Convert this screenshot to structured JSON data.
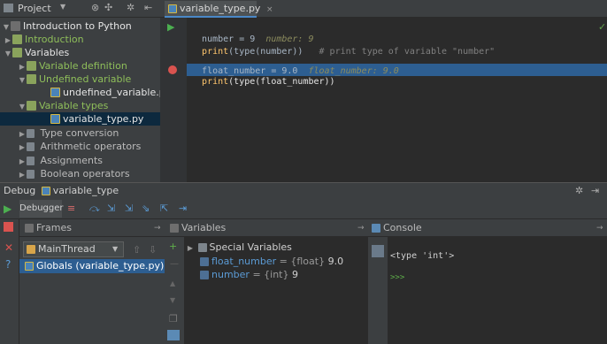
{
  "project_panel": {
    "title": "Project",
    "tree": [
      {
        "label": "Introduction to Python"
      },
      {
        "label": "Introduction"
      },
      {
        "label": "Variables"
      },
      {
        "label": "Variable definition"
      },
      {
        "label": "Undefined variable"
      },
      {
        "label": "undefined_variable.py"
      },
      {
        "label": "Variable types"
      },
      {
        "label": "variable_type.py"
      },
      {
        "label": "Type conversion"
      },
      {
        "label": "Arithmetic operators"
      },
      {
        "label": "Assignments"
      },
      {
        "label": "Boolean operators"
      }
    ]
  },
  "editor": {
    "tab_label": "variable_type.py",
    "lines": [
      {
        "a": "number = 9",
        "inline": "number: 9"
      },
      {
        "fn": "print",
        "rest": "(type(number))",
        "comment": "# print type of variable \"number\""
      },
      {
        "a": "float_number = 9.0",
        "inline": "float_number: 9.0"
      },
      {
        "fn": "print",
        "rest": "(type(float_number))"
      }
    ]
  },
  "debug": {
    "title_prefix": "Debug",
    "config_name": "variable_type",
    "debugger_tab": "Debugger",
    "frames": {
      "title": "Frames",
      "thread": "MainThread",
      "selected_frame": "Globals (variable_type.py)"
    },
    "variables": {
      "title": "Variables",
      "items": [
        {
          "name": "Special Variables",
          "type": "",
          "value": ""
        },
        {
          "name": "float_number",
          "type": "= {float}",
          "value": "9.0"
        },
        {
          "name": "number",
          "type": "= {int}",
          "value": "9"
        }
      ]
    },
    "console": {
      "title": "Console",
      "output": "<type 'int'>",
      "prompt": ">>>"
    }
  },
  "colors": {
    "accent": "#4a88c7",
    "selection": "#2d5e91",
    "panel": "#3c3f41",
    "editor_bg": "#2b2b2b"
  }
}
